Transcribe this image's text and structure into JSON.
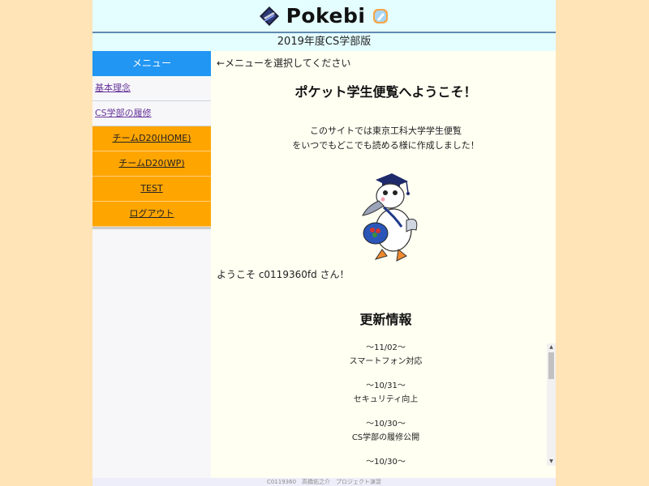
{
  "header": {
    "logo_text": "Pokebi",
    "subtitle": "2019年度CS学部版"
  },
  "sidebar": {
    "menu_heading": "メニュー",
    "links": [
      {
        "label": "基本理念"
      },
      {
        "label": "CS学部の履修"
      }
    ],
    "buttons": [
      {
        "label": "チームD20(HOME)"
      },
      {
        "label": "チームD20(WP)"
      },
      {
        "label": "TEST"
      },
      {
        "label": "ログアウト"
      }
    ]
  },
  "main": {
    "instruction": "←メニューを選択してください",
    "welcome_title": "ポケット学生便覧へようこそ！",
    "intro_line1": "このサイトでは東京工科大学学生便覧",
    "intro_line2": "をいつでもどこでも読める様に作成しました！",
    "greeting": "ようこそ c0119360fd さん！",
    "news_title": "更新情報",
    "news": [
      {
        "date": "～11/02～",
        "text": "スマートフォン対応"
      },
      {
        "date": "～10/31～",
        "text": "セキュリティ向上"
      },
      {
        "date": "～10/30～",
        "text": "CS学部の履修公開"
      },
      {
        "date": "～10/30～",
        "text": ""
      }
    ]
  },
  "footer": {
    "text": "C0119360　高橋佑之介　プロジェクト演習"
  },
  "colors": {
    "outer_background": "#ffe4b8",
    "header_background": "#e4fdff",
    "menu_heading": "#2196f3",
    "menu_button": "#ffa500",
    "main_background": "#fffff2",
    "link": "#663399"
  }
}
